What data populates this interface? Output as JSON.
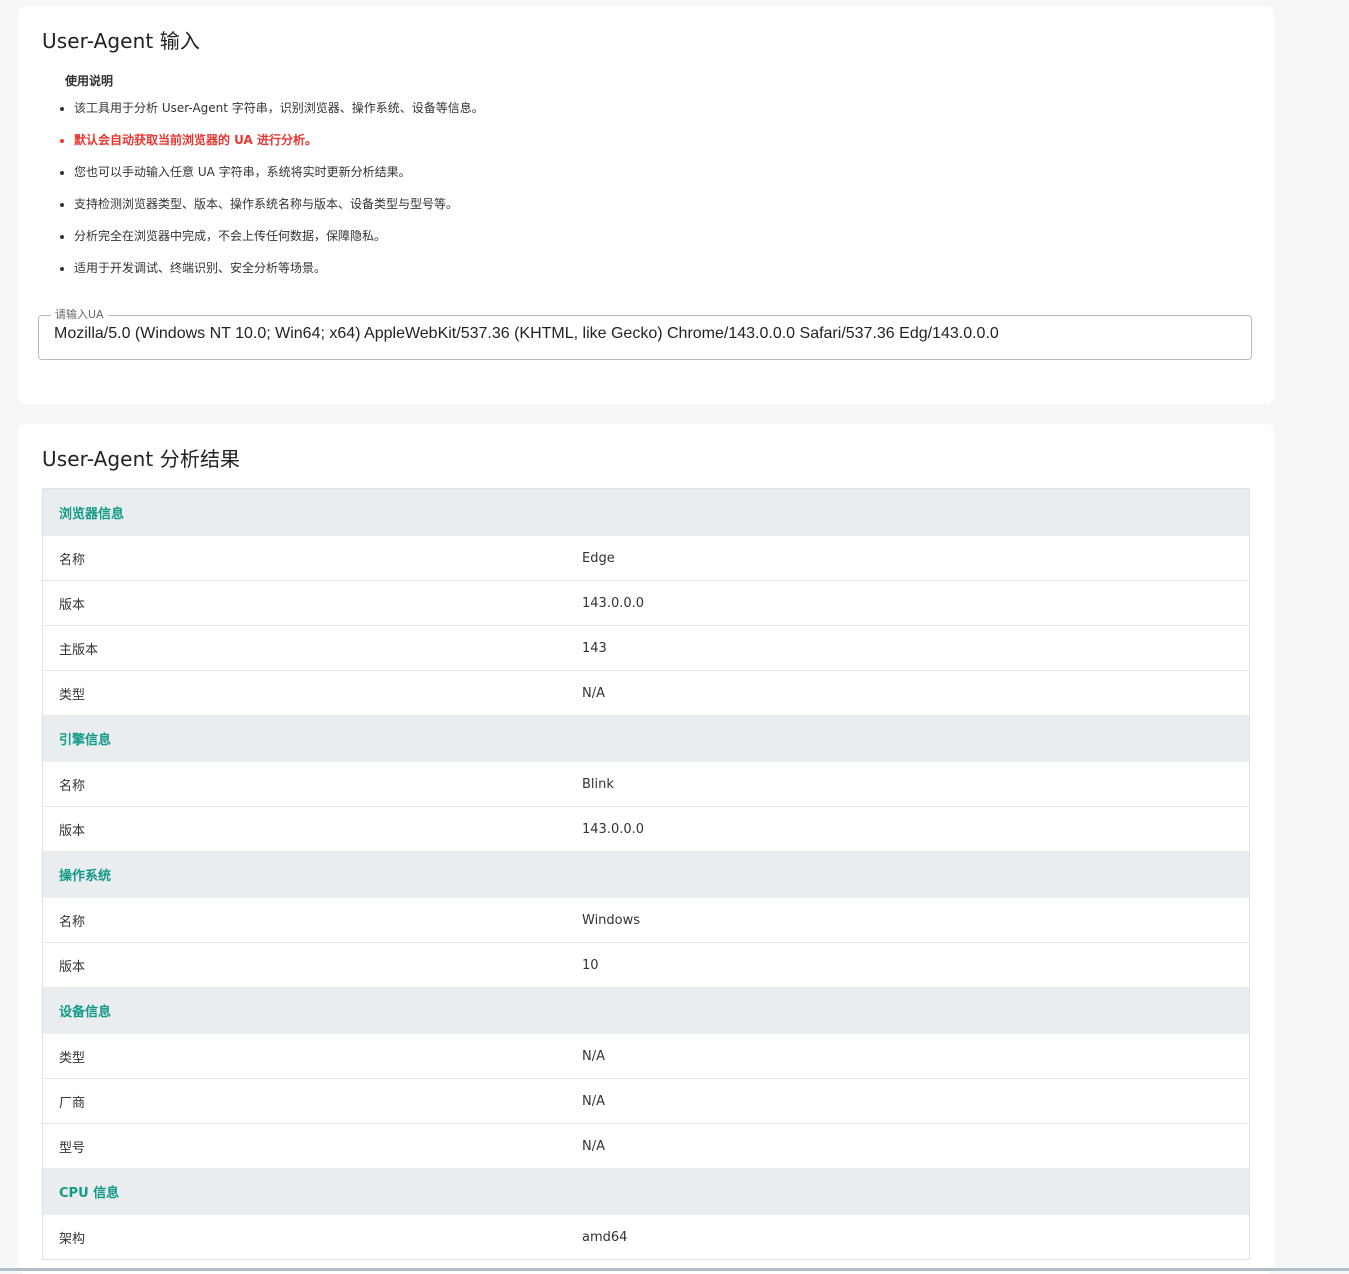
{
  "input_card": {
    "title": "User-Agent 输入",
    "help_title": "使用说明",
    "help_items": [
      "该工具用于分析 User-Agent 字符串，识别浏览器、操作系统、设备等信息。",
      "默认会自动获取当前浏览器的 UA 进行分析。",
      "您也可以手动输入任意 UA 字符串，系统将实时更新分析结果。",
      "支持检测浏览器类型、版本、操作系统名称与版本、设备类型与型号等。",
      "分析完全在浏览器中完成，不会上传任何数据，保障隐私。",
      "适用于开发调试、终端识别、安全分析等场景。"
    ],
    "field_label": "请输入UA",
    "ua_value": "Mozilla/5.0 (Windows NT 10.0; Win64; x64) AppleWebKit/537.36 (KHTML, like Gecko) Chrome/143.0.0.0 Safari/537.36 Edg/143.0.0.0"
  },
  "result_card": {
    "title": "User-Agent 分析结果",
    "sections": [
      {
        "title": "浏览器信息",
        "rows": [
          {
            "key": "名称",
            "value": "Edge"
          },
          {
            "key": "版本",
            "value": "143.0.0.0"
          },
          {
            "key": "主版本",
            "value": "143"
          },
          {
            "key": "类型",
            "value": "N/A"
          }
        ]
      },
      {
        "title": "引擎信息",
        "rows": [
          {
            "key": "名称",
            "value": "Blink"
          },
          {
            "key": "版本",
            "value": "143.0.0.0"
          }
        ]
      },
      {
        "title": "操作系统",
        "rows": [
          {
            "key": "名称",
            "value": "Windows"
          },
          {
            "key": "版本",
            "value": "10"
          }
        ]
      },
      {
        "title": "设备信息",
        "rows": [
          {
            "key": "类型",
            "value": "N/A"
          },
          {
            "key": "厂商",
            "value": "N/A"
          },
          {
            "key": "型号",
            "value": "N/A"
          }
        ]
      },
      {
        "title": "CPU 信息",
        "rows": [
          {
            "key": "架构",
            "value": "amd64"
          }
        ]
      }
    ]
  },
  "colors": {
    "section_title": "#139a86",
    "warning_text": "#e53935",
    "section_background": "#e9edf0"
  }
}
